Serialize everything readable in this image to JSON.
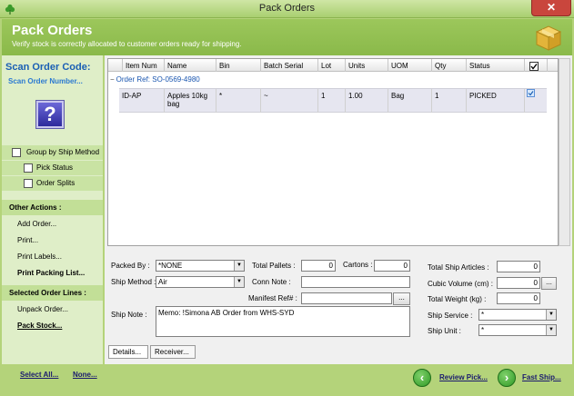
{
  "window": {
    "title": "Pack Orders"
  },
  "header": {
    "title": "Pack Orders",
    "subtitle": "Verify stock is correctly allocated to customer orders ready for shipping."
  },
  "left": {
    "scan_title": "Scan Order Code:",
    "scan_placeholder": "Scan Order Number...",
    "options": [
      {
        "label": "Group by Ship Method",
        "checked": false
      },
      {
        "label": "Pick Status",
        "checked": false
      },
      {
        "label": "Order Splits",
        "checked": false
      }
    ],
    "other_actions_title": "Other Actions :",
    "other_actions": [
      "Add Order...",
      "Print...",
      "Print Labels...",
      "Print Packing List..."
    ],
    "selected_title": "Selected Order Lines :",
    "selected_actions": [
      "Unpack Order...",
      "Pack Stock..."
    ]
  },
  "grid": {
    "columns": [
      "Item Num",
      "Name",
      "Bin",
      "Batch Serial",
      "Lot",
      "Units",
      "UOM",
      "Qty",
      "Status"
    ],
    "group_label": "Order Ref: SO-0569-4980",
    "group_toggle": "−",
    "rows": [
      {
        "item": "ID-AP",
        "name_l1": "Apples 10kg",
        "name_l2": "bag",
        "bin": "*",
        "batch": "~",
        "lot": "1",
        "units": "1.00",
        "uom": "Bag",
        "qty": "1",
        "status": "PICKED",
        "checked": true
      }
    ]
  },
  "form": {
    "packed_by_label": "Packed By :",
    "packed_by": "*NONE",
    "ship_method_label": "Ship Method :",
    "ship_method": "Air",
    "ship_note_label": "Ship Note :",
    "total_pallets_label": "Total Pallets :",
    "total_pallets": "0",
    "cartons_label": "Cartons :",
    "cartons": "0",
    "conn_note_label": "Conn Note :",
    "conn_note": "",
    "manifest_label": "Manifest Ref# :",
    "manifest": "",
    "memo": "Memo: !Simona AB Order from WHS-SYD",
    "total_ship_articles_label": "Total Ship Articles :",
    "total_ship_articles": "0",
    "cubic_volume_label": "Cubic Volume (cm) :",
    "cubic_volume": "0",
    "total_weight_label": "Total Weight (kg) :",
    "total_weight": "0",
    "ship_service_label": "Ship Service :",
    "ship_service": "*",
    "ship_unit_label": "Ship Unit :",
    "ship_unit": "*",
    "ellipsis": "..."
  },
  "tabs": [
    "Details...",
    "Receiver..."
  ],
  "footer": {
    "select_all": "Select All...",
    "none": "None...",
    "review_pick": "Review Pick...",
    "fast_ship": "Fast Ship..."
  },
  "colors": {
    "accent": "#9cc75b",
    "link": "#1a5fb4",
    "close": "#c9463d"
  }
}
